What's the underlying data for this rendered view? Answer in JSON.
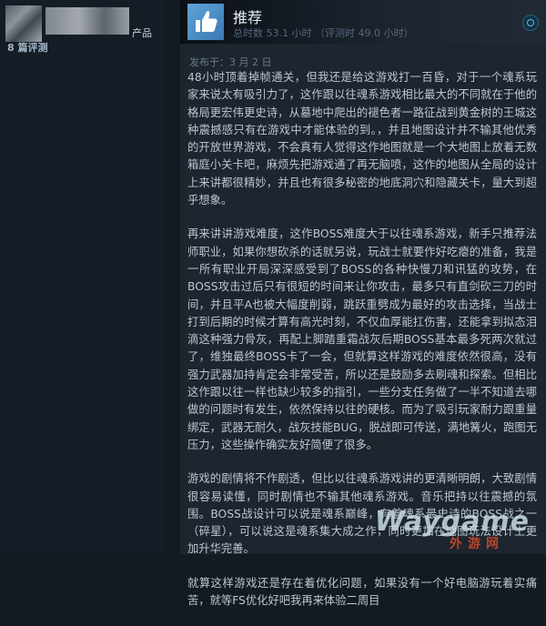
{
  "author": {
    "suffix": "产品",
    "review_count": "8 篇评测"
  },
  "review": {
    "vote_label": "推荐",
    "hours_text": "总时数 53.1 小时 （评测时 49.0 小时）",
    "posted": "发布于：3 月 2 日",
    "paragraphs": [
      "48小时顶着掉帧通关，但我还是给这游戏打一百昏，对于一个魂系玩家来说太有吸引力了，这作跟以往魂系游戏相比最大的不同就在于他的格局更宏伟更史诗，从墓地中爬出的褪色者一路征战到黄金树的王城这种震撼感只有在游戏中才能体验的到。，并且地图设计并不输其他优秀的开放世界游戏，不会真有人觉得这作地图就是一个大地图上放着无数箱庭小关卡吧，麻烦先把游戏通了再无脑喷，这作的地图从全局的设计上来讲都很精妙，并且也有很多秘密的地底洞穴和隐藏关卡，量大到超乎想象。",
      "再来讲讲游戏难度，这作BOSS难度大于以往魂系游戏，新手只推荐法师职业，如果你想砍杀的话就另说，玩战士就要作好吃瘪的准备，我是一所有职业开局深深感受到了BOSS的各种快慢刀和讯猛的攻势，在BOSS攻击过后只有很短的时间来让你攻击，最多只有直剑砍三刀的时间，并且平A也被大幅度削弱，跳跃重劈成为最好的攻击选择，当战士打到后期的时候才算有高光时刻，不仅血厚能扛伤害，还能拿到拟态泪滴这种强力骨灰，再配上脚踏重霜战灰后期BOSS基本最多死两次就过了，维独最终BOSS卡了一会，但就算这样游戏的难度依然很高，没有强力武器加持肯定会非常受苦，所以还是鼓励多去刷魂和探索。但相比这作跟以往一样也缺少较多的指引，一些分支任务做了一半不知道去哪做的问题时有发生，依然保持以往的硬核。而为了吸引玩家耐力跟重量绑定，武器无耐久，战灰技能BUG，脱战即可传送，满地篝火，跑图无压力，这些操作确实友好简便了很多。",
      "游戏的剧情将不作剧透，但比以往魂系游戏讲的更清晰明朗，大致剧情很容易读懂，同时剧情也不输其他魂系游戏。音乐把持以往震撼的氛围。BOSS战设计可以说是魂系巅峰，有着魂系最史诗的BOSS战之一（碎星），可以说这是魂系集大成之作，同时更加在地图玩法设计上更加升华完善。",
      "就算这样游戏还是存在着优化问题，如果没有一个好电脑游玩着实痛苦，就等FS优化好吧我再来体验二周目"
    ]
  },
  "watermark": {
    "text": "Waygame",
    "cn": "外游网"
  },
  "colors": {
    "accent": "#66c0f4",
    "thumb_bg": "#4b8ac4",
    "body_text": "#bcc7d1"
  }
}
